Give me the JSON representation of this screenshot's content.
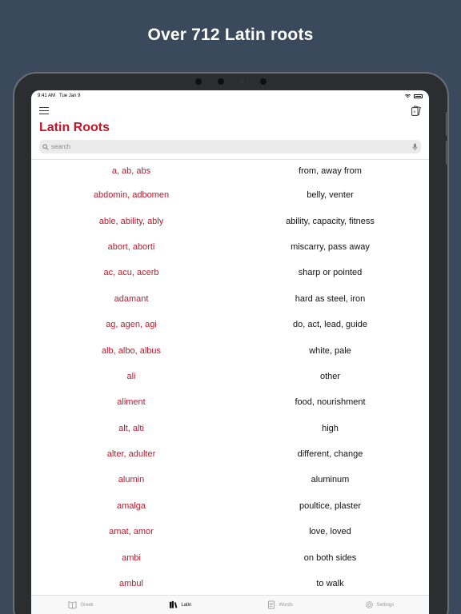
{
  "promo": {
    "title": "Over 712 Latin roots"
  },
  "status_bar": {
    "time": "9:41 AM",
    "date": "Tue Jan 9"
  },
  "header": {
    "title": "Latin Roots"
  },
  "search": {
    "placeholder": "search"
  },
  "colors": {
    "accent": "#c0182a",
    "background": "#3a4a5c"
  },
  "roots": [
    {
      "root": "a, ab, abs",
      "meaning": "from, away from"
    },
    {
      "root": "abdomin, adbomen",
      "meaning": "belly, venter"
    },
    {
      "root": "able, ability, ably",
      "meaning": "ability, capacity, fitness"
    },
    {
      "root": "abort, aborti",
      "meaning": "miscarry, pass away"
    },
    {
      "root": "ac, acu, acerb",
      "meaning": "sharp or pointed"
    },
    {
      "root": "adamant",
      "meaning": "hard as steel, iron"
    },
    {
      "root": "ag, agen, agi",
      "meaning": "do, act, lead, guide"
    },
    {
      "root": "alb, albo, albus",
      "meaning": "white, pale"
    },
    {
      "root": "ali",
      "meaning": "other"
    },
    {
      "root": "aliment",
      "meaning": "food, nourishment"
    },
    {
      "root": "alt, alti",
      "meaning": "high"
    },
    {
      "root": "alter, adulter",
      "meaning": "different, change"
    },
    {
      "root": "alumin",
      "meaning": "aluminum"
    },
    {
      "root": "amalga",
      "meaning": "poultice, plaster"
    },
    {
      "root": "amat, amor",
      "meaning": "love, loved"
    },
    {
      "root": "ambi",
      "meaning": "on both sides"
    },
    {
      "root": "ambul",
      "meaning": "to walk"
    }
  ],
  "tabs": [
    {
      "label": "Greek",
      "icon": "book-icon",
      "active": false
    },
    {
      "label": "Latin",
      "icon": "books-icon",
      "active": true
    },
    {
      "label": "Words",
      "icon": "word-list-icon",
      "active": false
    },
    {
      "label": "Settings",
      "icon": "gear-icon",
      "active": false
    }
  ]
}
